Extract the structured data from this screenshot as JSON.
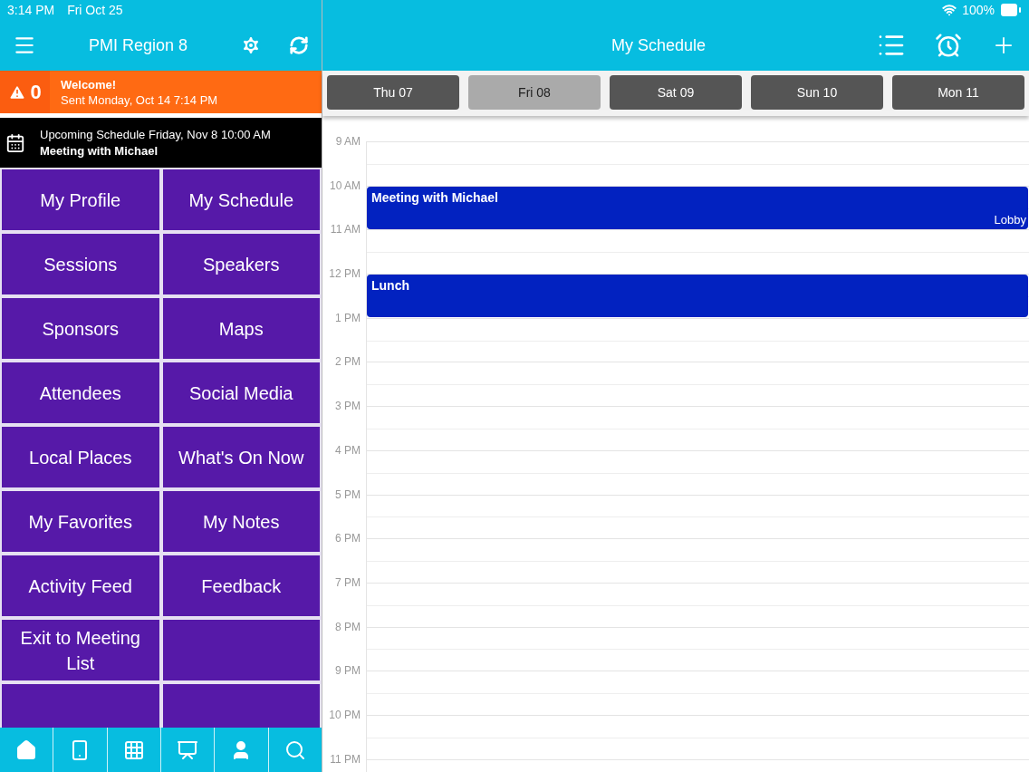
{
  "status_bar": {
    "time": "3:14 PM",
    "date": "Fri Oct 25",
    "battery": "100%"
  },
  "sidebar": {
    "title": "PMI Region 8",
    "alert": {
      "count": "0",
      "title": "Welcome!",
      "subtitle": "Sent Monday, Oct 14 7:14 PM"
    },
    "upcoming": {
      "line": "Upcoming Schedule Friday, Nov 8 10:00 AM",
      "title": "Meeting with Michael"
    },
    "tiles": [
      {
        "kind": "label",
        "label": "My Profile"
      },
      {
        "kind": "label",
        "label": "My Schedule"
      },
      {
        "kind": "label",
        "label": "Sessions"
      },
      {
        "kind": "label",
        "label": "Speakers"
      },
      {
        "kind": "label",
        "label": "Sponsors"
      },
      {
        "kind": "label",
        "label": "Maps"
      },
      {
        "kind": "label",
        "label": "Attendees"
      },
      {
        "kind": "label",
        "label": "Social Media"
      },
      {
        "kind": "label",
        "label": "Local Places"
      },
      {
        "kind": "label",
        "label": "What's On Now"
      },
      {
        "kind": "label",
        "label": "My Favorites"
      },
      {
        "kind": "label",
        "label": "My Notes"
      },
      {
        "kind": "label",
        "label": "Activity Feed"
      },
      {
        "kind": "label",
        "label": "Feedback"
      },
      {
        "kind": "label",
        "label": "Exit to Meeting List"
      },
      {
        "kind": "empty"
      },
      {
        "kind": "empty"
      },
      {
        "kind": "empty"
      }
    ],
    "tab_bar": [
      {
        "kind": "home"
      },
      {
        "kind": "phone"
      },
      {
        "kind": "grid"
      },
      {
        "kind": "easel"
      },
      {
        "kind": "speaker"
      },
      {
        "kind": "search"
      }
    ]
  },
  "schedule": {
    "title": "My Schedule",
    "days": [
      {
        "label": "Thu 07",
        "selected": false
      },
      {
        "label": "Fri 08",
        "selected": true
      },
      {
        "label": "Sat 09",
        "selected": false
      },
      {
        "label": "Sun 10",
        "selected": false
      },
      {
        "label": "Mon 11",
        "selected": false
      }
    ],
    "hours": [
      {
        "label": "9 AM"
      },
      {
        "label": "10 AM",
        "events": [
          {
            "title": "Meeting with Michael",
            "location": "Lobby"
          }
        ]
      },
      {
        "label": "11 AM"
      },
      {
        "label": "12 PM",
        "events": [
          {
            "title": "Lunch"
          }
        ]
      },
      {
        "label": "1 PM"
      },
      {
        "label": "2 PM"
      },
      {
        "label": "3 PM"
      },
      {
        "label": "4 PM"
      },
      {
        "label": "5 PM"
      },
      {
        "label": "6 PM"
      },
      {
        "label": "7 PM"
      },
      {
        "label": "8 PM"
      },
      {
        "label": "9 PM"
      },
      {
        "label": "10 PM"
      },
      {
        "label": "11 PM"
      }
    ]
  }
}
